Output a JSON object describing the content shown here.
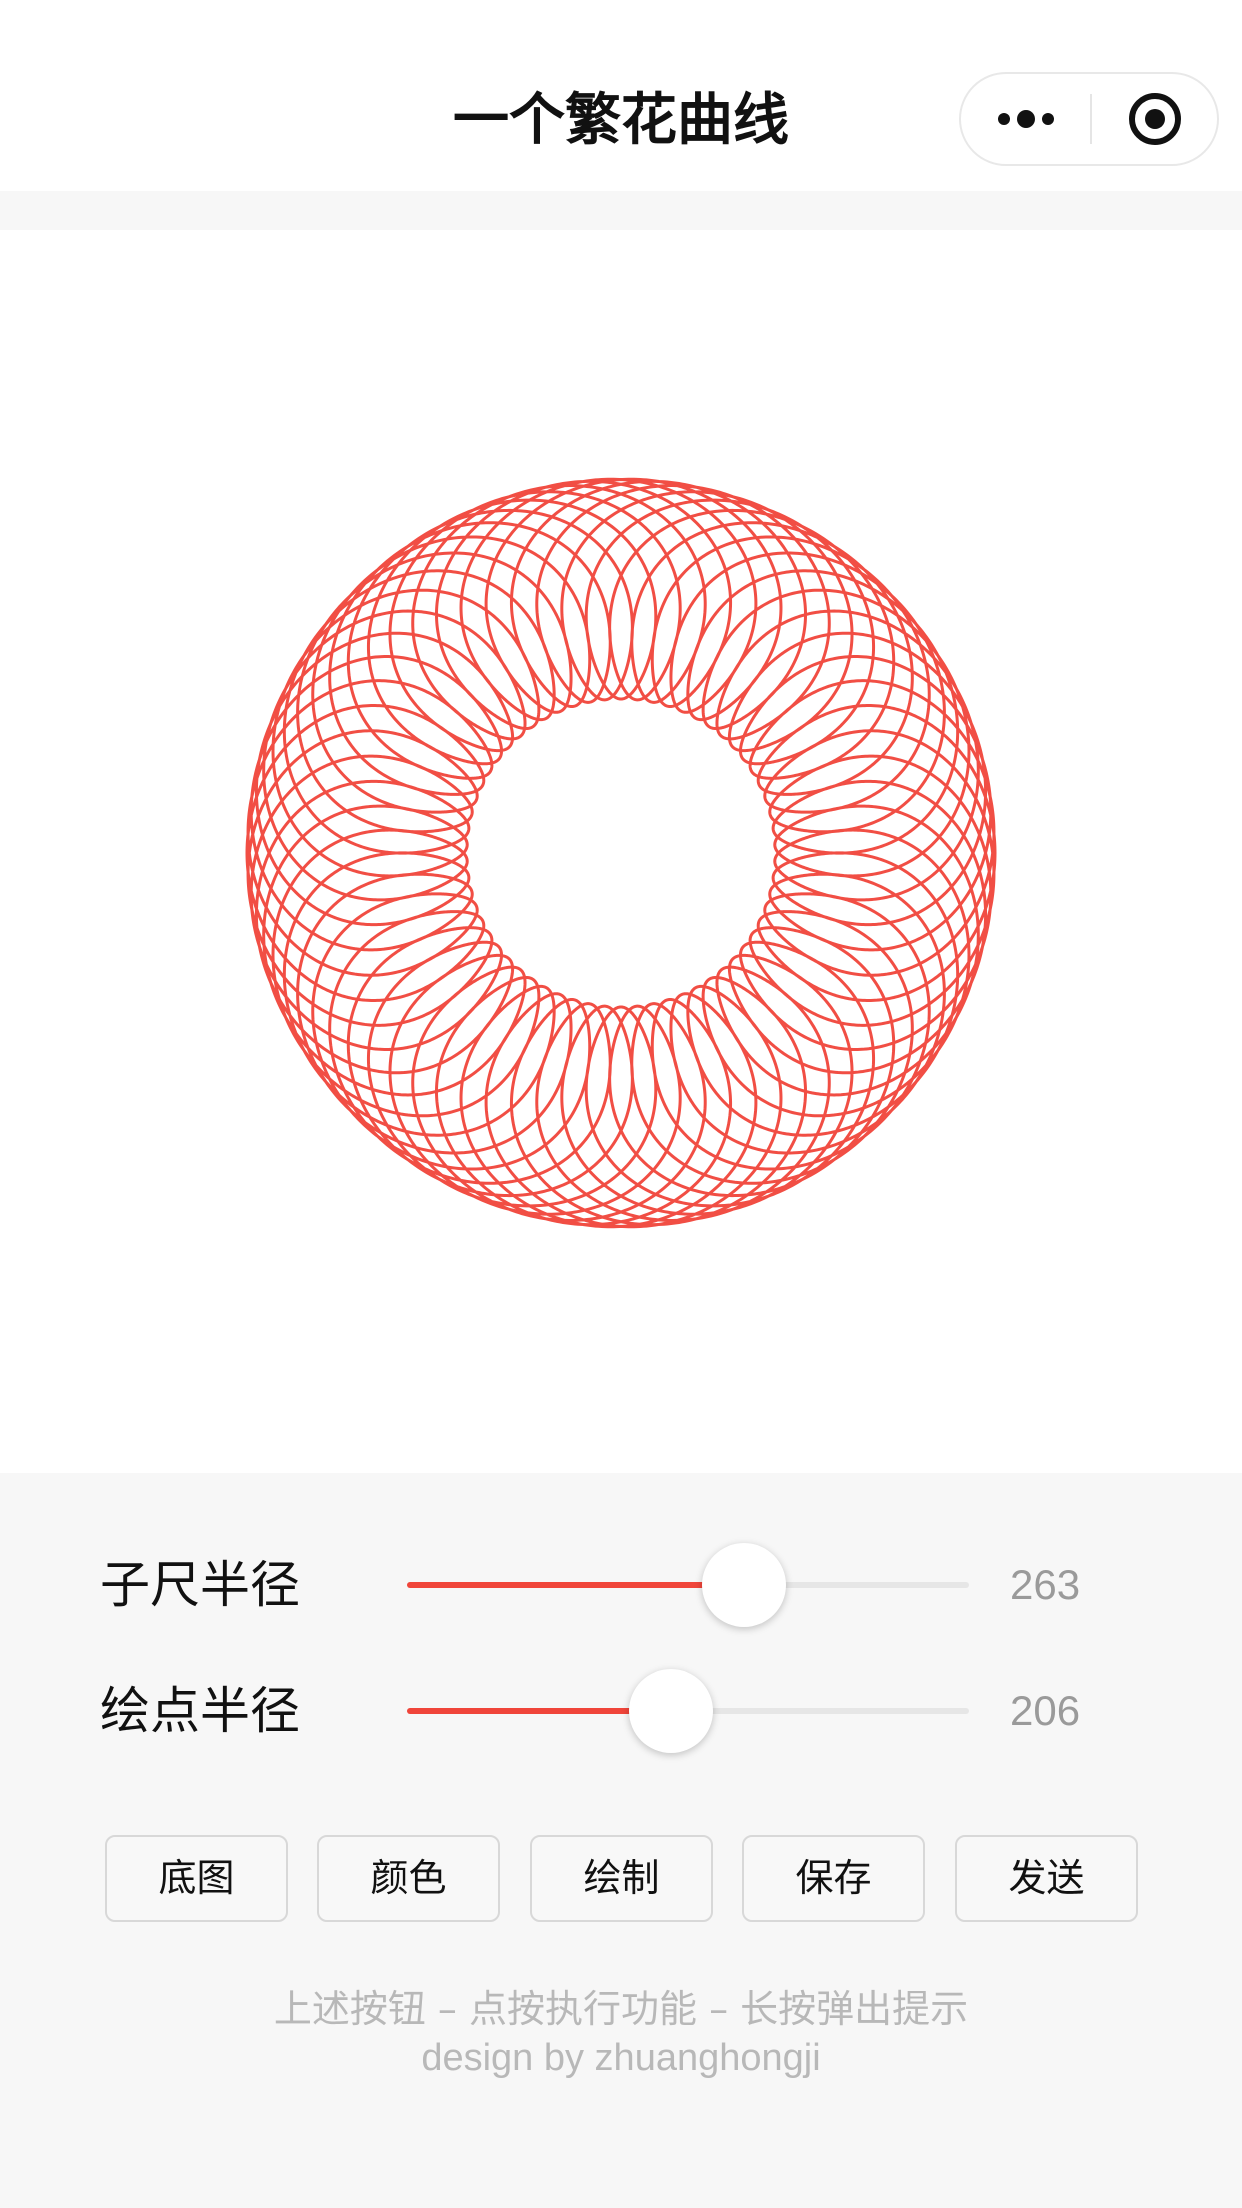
{
  "nav": {
    "title": "一个繁花曲线",
    "more_icon": "more-dots-icon",
    "close_icon": "target-close-icon"
  },
  "canvas": {
    "curve_color": "#f0453a",
    "background": "#ffffff"
  },
  "controls": [
    {
      "label": "子尺半径",
      "value": "263",
      "fraction": 0.6
    },
    {
      "label": "绘点半径",
      "value": "206",
      "fraction": 0.47
    }
  ],
  "buttons": [
    "底图",
    "颜色",
    "绘制",
    "保存",
    "发送"
  ],
  "hint": {
    "line1": "上述按钮 – 点按执行功能 – 长按弹出提示",
    "line2": "design by zhuanghongji"
  },
  "colors": {
    "accent": "#f0453a",
    "page_bg": "#f7f7f7",
    "hint_text": "#b8b8b8"
  }
}
